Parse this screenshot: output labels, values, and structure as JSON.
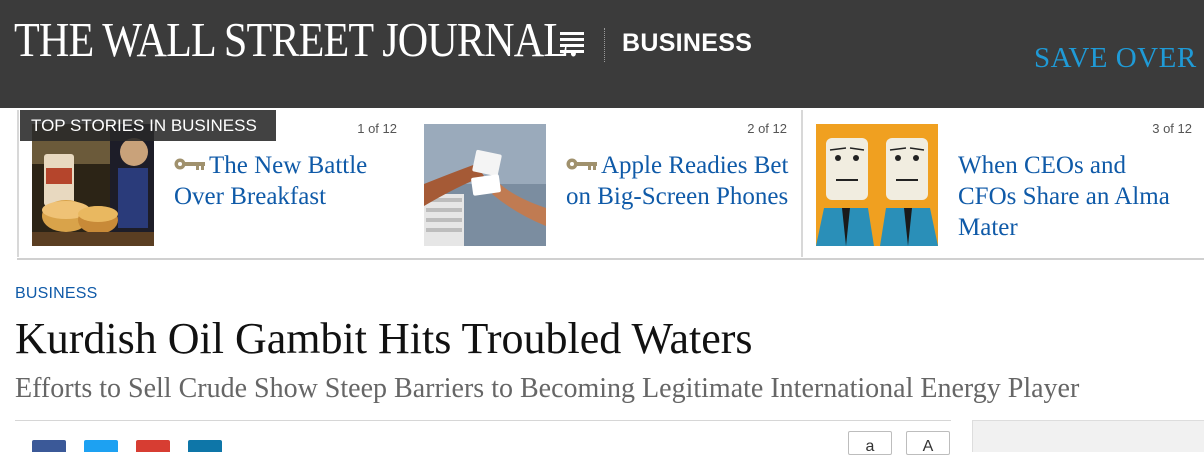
{
  "header": {
    "logo": "THE WALL STREET JOURNAL.",
    "section": "BUSINESS",
    "promo": "SAVE OVER"
  },
  "top_stories": {
    "label": "TOP STORIES IN BUSINESS",
    "items": [
      {
        "counter": "1 of 12",
        "title": "The New Battle Over Breakfast",
        "subscriber_key": true,
        "thumb_icon": "breakfast-photo"
      },
      {
        "counter": "2 of 12",
        "title": "Apple Readies Bet on Big-Screen Phones",
        "subscriber_key": true,
        "thumb_icon": "phone-handoff-photo"
      },
      {
        "counter": "3 of 12",
        "title": "When CEOs and CFOs Share an Alma Mater",
        "subscriber_key": false,
        "thumb_icon": "two-faces-illustration"
      }
    ]
  },
  "article": {
    "kicker": "BUSINESS",
    "headline": "Kurdish Oil Gambit Hits Troubled Waters",
    "dek": "Efforts to Sell Crude Show Steep Barriers to Becoming Legitimate International Energy Player"
  },
  "share": {
    "icons": [
      "facebook-icon",
      "twitter-icon",
      "google-plus-icon",
      "linkedin-icon"
    ],
    "colors": {
      "facebook": "#3b5998",
      "twitter": "#1da1f2",
      "google": "#d73d32",
      "linkedin": "#0e76a8"
    }
  },
  "text_size": {
    "smaller": "a",
    "larger": "A"
  },
  "colors": {
    "header_bg": "#3b3b3b",
    "link_blue": "#0f5aa8",
    "promo_blue": "#1f9ad6"
  }
}
